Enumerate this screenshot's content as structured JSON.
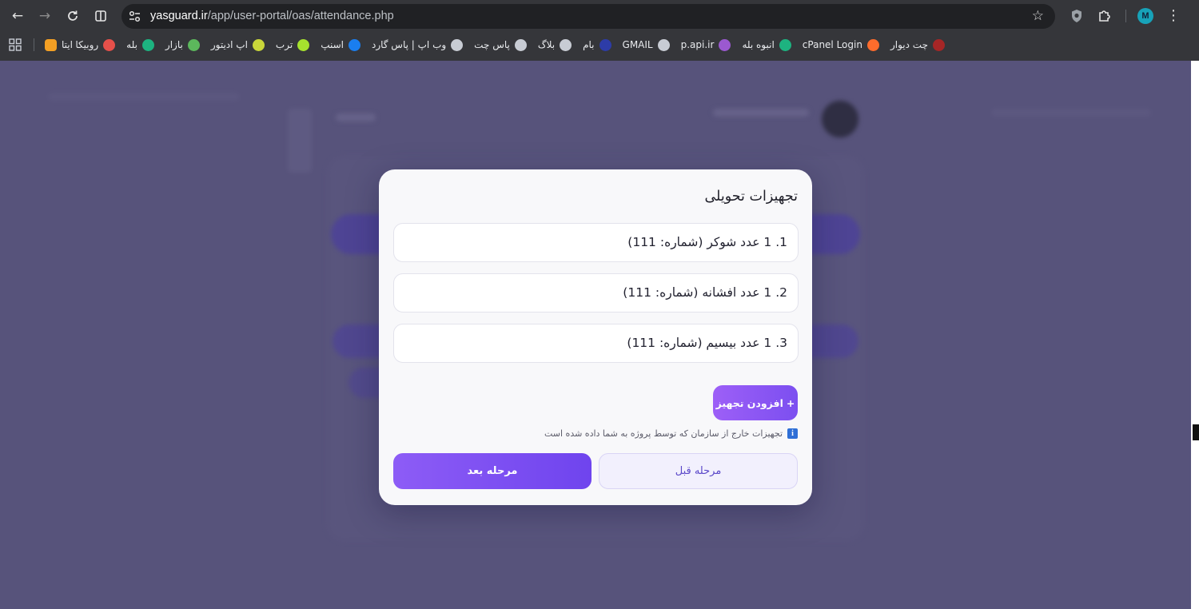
{
  "browser": {
    "url_host": "yasguard.ir",
    "url_path": "/app/user-portal/oas/attendance.php",
    "profile_initial": "M",
    "bookmarks": [
      {
        "label": "چت دیوار",
        "icon": "divar-icon",
        "color": "#a62626"
      },
      {
        "label": "cPanel Login",
        "icon": "cpanel-icon",
        "color": "#ff6c2c"
      },
      {
        "label": "انبوه بله",
        "icon": "bale-check-icon",
        "color": "#1db380"
      },
      {
        "label": "p.api.ir",
        "icon": "api-icon",
        "color": "#9b59d0"
      },
      {
        "label": "GMAIL",
        "icon": "globe-icon",
        "color": "#c8ccd4"
      },
      {
        "label": "بام",
        "icon": "bam-icon",
        "color": "#2d3ca8"
      },
      {
        "label": "بلاگ",
        "icon": "blog-icon",
        "color": "#c8ccd4"
      },
      {
        "label": "پاس چت",
        "icon": "paschat-icon",
        "color": "#c8ccd4"
      },
      {
        "label": "وب اپ | پاس گارد",
        "icon": "pasguard-icon",
        "color": "#c8ccd4"
      },
      {
        "label": "اسنپ",
        "icon": "snapp-icon",
        "color": "#1a7ef0"
      },
      {
        "label": "ترب",
        "icon": "torob-icon",
        "color": "#a6e22e"
      },
      {
        "label": "اپ ادیتور",
        "icon": "editor-icon",
        "color": "#c9d63a"
      },
      {
        "label": "بازار",
        "icon": "bazaar-icon",
        "color": "#5cb85c"
      },
      {
        "label": "بله",
        "icon": "bale-icon",
        "color": "#1db380"
      },
      {
        "label": "روبیکا",
        "icon": "rubika-icon",
        "color": "#e6504a"
      }
    ],
    "bookmark_first": {
      "label": "ایتا",
      "icon": "eitaa-icon",
      "color": "#f4a024"
    }
  },
  "modal": {
    "title": "تجهیزات تحویلی",
    "items": [
      {
        "text": "1. 1 عدد شوکر (شماره: 111)"
      },
      {
        "text": "2. 1 عدد افشانه (شماره: 111)"
      },
      {
        "text": "3. 1 عدد بیسیم (شماره: 111)"
      }
    ],
    "add_button": "افزودن تجهیز",
    "add_button_prefix": "+",
    "hint": "تجهیزات خارج از سازمان که توسط پروژه به شما داده شده است",
    "info_glyph": "i",
    "prev_button": "مرحله قبل",
    "next_button": "مرحله بعد",
    "accent": "#7c4ff0"
  }
}
